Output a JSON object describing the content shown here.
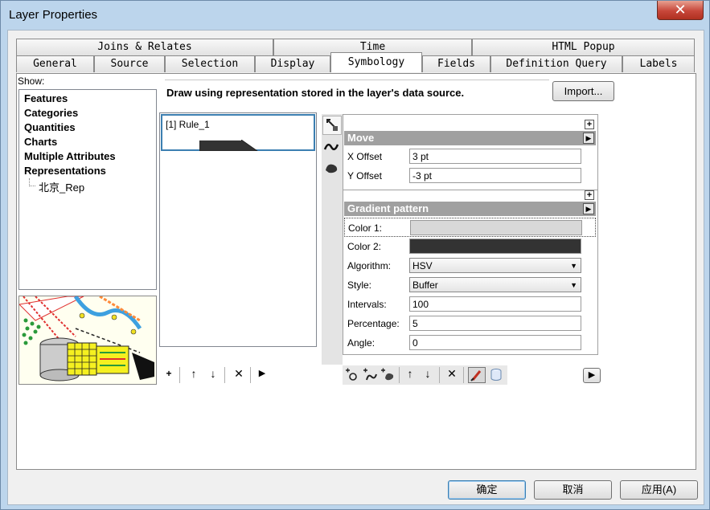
{
  "window": {
    "title": "Layer Properties",
    "close_label": "✕"
  },
  "tabs_back": [
    "Joins & Relates",
    "Time",
    "HTML Popup"
  ],
  "tabs_front": [
    "General",
    "Source",
    "Selection",
    "Display",
    "Symbology",
    "Fields",
    "Definition Query",
    "Labels"
  ],
  "active_tab": "Symbology",
  "show": {
    "label": "Show:",
    "items": [
      "Features",
      "Categories",
      "Quantities",
      "Charts",
      "Multiple Attributes",
      "Representations"
    ],
    "subitem": "北京_Rep"
  },
  "description": "Draw using representation stored in the layer's data source.",
  "import_button": "Import...",
  "rules": {
    "items": [
      "[1] Rule_1"
    ]
  },
  "rule_toolbar": {
    "add": "+",
    "up": "↑",
    "down": "↓",
    "delete": "✕",
    "more": "▶"
  },
  "properties": {
    "move": {
      "header": "Move",
      "rows": [
        {
          "label": "X Offset",
          "value": "3 pt"
        },
        {
          "label": "Y Offset",
          "value": "-3 pt"
        }
      ]
    },
    "gradient": {
      "header": "Gradient pattern",
      "color1_label": "Color 1:",
      "color1": "#d8d8d8",
      "color2_label": "Color 2:",
      "color2": "#333333",
      "algorithm_label": "Algorithm:",
      "algorithm_value": "HSV",
      "style_label": "Style:",
      "style_value": "Buffer",
      "intervals_label": "Intervals:",
      "intervals_value": "100",
      "percentage_label": "Percentage:",
      "percentage_value": "5",
      "angle_label": "Angle:",
      "angle_value": "0"
    }
  },
  "footer": {
    "ok": "确定",
    "cancel": "取消",
    "apply": "应用(A)"
  },
  "colors": {
    "accent_blue": "#3c7fb1",
    "window_frame": "#bcd5ec",
    "header_gray": "#a0a0a0"
  }
}
